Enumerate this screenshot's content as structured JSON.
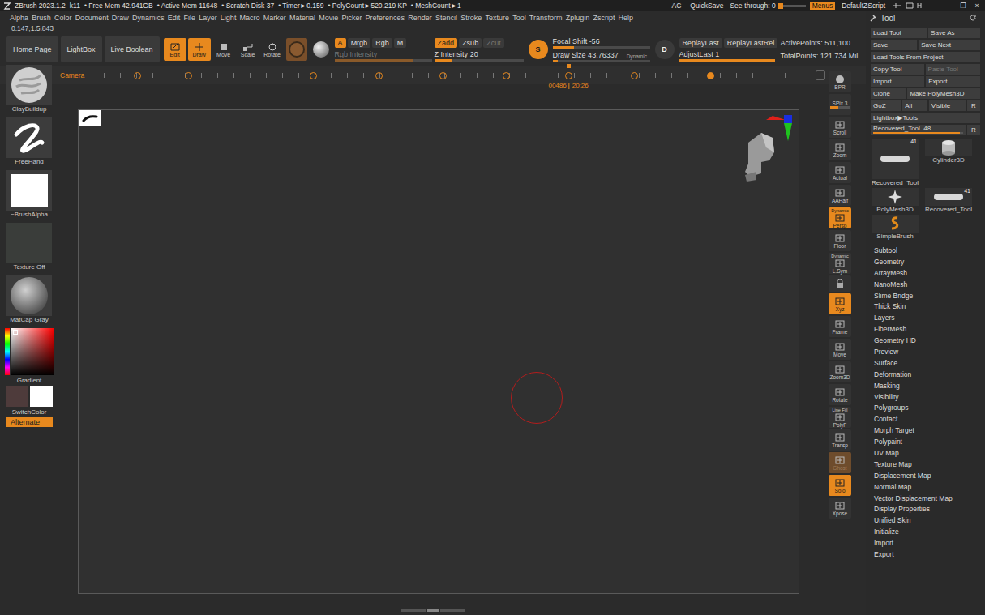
{
  "window": {
    "app": "ZBrush 2023.1.2",
    "status": [
      "k11",
      "• Free Mem 42.941GB",
      "• Active Mem 11648",
      "• Scratch Disk 37",
      "• Timer►0.159",
      "• PolyCount►520.219 KP",
      "• MeshCount►1"
    ],
    "right": [
      {
        "label": "AC",
        "selected": false
      },
      {
        "label": "QuickSave",
        "selected": false
      }
    ],
    "see_through": {
      "label": "See-through",
      "value": "0",
      "level": 0
    },
    "menus": {
      "label": "Menus",
      "selected": true
    },
    "script": "DefaultZScript",
    "controls": [
      "—",
      "❐",
      "×"
    ]
  },
  "menubar": [
    "Alpha",
    "Brush",
    "Color",
    "Document",
    "Draw",
    "Dynamics",
    "Edit",
    "File",
    "Layer",
    "Light",
    "Macro",
    "Marker",
    "Material",
    "Movie",
    "Picker",
    "Preferences",
    "Render",
    "Stencil",
    "Stroke",
    "Texture",
    "Tool",
    "Transform",
    "Zplugin",
    "Zscript",
    "Help"
  ],
  "coords": "0.147,1.5.843",
  "shelf": {
    "nav": [
      "Home Page",
      "LightBox",
      "Live Boolean"
    ],
    "modes": [
      {
        "label": "Edit",
        "selected": true
      },
      {
        "label": "Draw",
        "selected": true
      },
      {
        "label": "Move",
        "selected": false
      },
      {
        "label": "Scale",
        "selected": false
      },
      {
        "label": "Rotate",
        "selected": false
      }
    ],
    "rgb": [
      {
        "label": "A",
        "selected": true
      },
      {
        "label": "Mrgb",
        "selected": false
      },
      {
        "label": "Rgb",
        "selected": false
      },
      {
        "label": "M",
        "selected": false
      }
    ],
    "rgb_intensity": {
      "label": "Rgb Intensity",
      "level": 0.8,
      "disabled": true
    },
    "zmodes": [
      {
        "label": "Zadd",
        "selected": true,
        "disabled": false
      },
      {
        "label": "Zsub",
        "selected": false,
        "disabled": false
      },
      {
        "label": "Zcut",
        "selected": false,
        "disabled": true
      }
    ],
    "z_intensity": {
      "label": "Z Intensity 20",
      "level": 0.2
    },
    "s_button": "S",
    "focal_shift": {
      "label": "Focal Shift -56",
      "level": 0.22
    },
    "draw_size": {
      "label": "Draw Size 43.76337",
      "level": 0.05
    },
    "dynamic": "Dynamic",
    "d_button": "D",
    "replay": [
      "ReplayLast",
      "ReplayLastRel"
    ],
    "adjust_last": {
      "label": "AdjustLast 1",
      "level": 1
    },
    "active_points": "ActivePoints: 511,100",
    "total_points": "TotalPoints: 121.734 Mil"
  },
  "timeline": {
    "label": "Camera",
    "frame": "00486",
    "clock": "20:26",
    "cursor": 0.671,
    "keys": [
      {
        "pos": 0.048,
        "selected": false
      },
      {
        "pos": 0.121,
        "selected": false
      },
      {
        "pos": 0.302,
        "selected": false
      },
      {
        "pos": 0.397,
        "selected": false
      },
      {
        "pos": 0.489,
        "selected": false
      },
      {
        "pos": 0.581,
        "selected": false
      },
      {
        "pos": 0.671,
        "selected": false
      },
      {
        "pos": 0.766,
        "selected": false
      },
      {
        "pos": 0.876,
        "selected": true
      }
    ]
  },
  "tray": {
    "items": [
      {
        "label": "ClayBuildup",
        "kind": "brush"
      },
      {
        "label": "FreeHand",
        "kind": "stroke"
      },
      {
        "label": "~BrushAlpha",
        "kind": "alpha"
      },
      {
        "label": "Texture Off",
        "kind": "texture"
      },
      {
        "label": "MatCap Gray",
        "kind": "material"
      }
    ],
    "gradient": "Gradient",
    "switch_color": "SwitchColor",
    "alternate": {
      "label": "Alternate",
      "selected": true
    },
    "main_color": "#4e3b3b",
    "secondary_color": "#ffffff"
  },
  "rshelf": [
    {
      "label": "BPR",
      "sub": "",
      "selected": false,
      "dimmed": false
    },
    {
      "label": "SPix 3",
      "sub": "",
      "selected": false,
      "dimmed": false,
      "kind": "slider"
    },
    {
      "label": "Scroll",
      "sub": "",
      "selected": false,
      "dimmed": false
    },
    {
      "label": "Zoom",
      "sub": "",
      "selected": false,
      "dimmed": false
    },
    {
      "label": "Actual",
      "sub": "",
      "selected": false,
      "dimmed": false
    },
    {
      "label": "AAHalf",
      "sub": "",
      "selected": false,
      "dimmed": false
    },
    {
      "label": "Persp",
      "sub": "Dynamic",
      "selected": true,
      "dimmed": false
    },
    {
      "label": "Floor",
      "sub": "",
      "selected": false,
      "dimmed": false
    },
    {
      "label": "L.Sym",
      "sub": "Dynamic",
      "selected": false,
      "dimmed": false
    },
    {
      "label": "",
      "sub": "",
      "selected": false,
      "dimmed": false
    },
    {
      "label": "Xyz",
      "sub": "",
      "selected": true,
      "dimmed": false
    },
    {
      "label": "Frame",
      "sub": "",
      "selected": false,
      "dimmed": false
    },
    {
      "label": "Move",
      "sub": "",
      "selected": false,
      "dimmed": false
    },
    {
      "label": "Zoom3D",
      "sub": "",
      "selected": false,
      "dimmed": false
    },
    {
      "label": "Rotate",
      "sub": "",
      "selected": false,
      "dimmed": false
    },
    {
      "label": "PolyF",
      "sub": "Line Fill",
      "selected": false,
      "dimmed": false
    },
    {
      "label": "Transp",
      "sub": "",
      "selected": false,
      "dimmed": false
    },
    {
      "label": "Ghost",
      "sub": "",
      "selected": false,
      "dimmed": true
    },
    {
      "label": "Solo",
      "sub": "",
      "selected": true,
      "dimmed": false
    },
    {
      "label": "Xpose",
      "sub": "",
      "selected": false,
      "dimmed": false
    }
  ],
  "tool": {
    "title": "Tool",
    "rows": [
      [
        {
          "label": "Load Tool",
          "disabled": false
        },
        {
          "label": "Save As",
          "disabled": false
        }
      ],
      [
        {
          "label": "Save",
          "disabled": false
        },
        {
          "label": "Save Next",
          "disabled": false
        }
      ],
      [
        {
          "label": "Load Tools From Project",
          "disabled": false
        }
      ],
      [
        {
          "label": "Copy Tool",
          "disabled": false
        },
        {
          "label": "Paste Tool",
          "disabled": true
        }
      ],
      [
        {
          "label": "Import",
          "disabled": false
        },
        {
          "label": "Export",
          "disabled": false
        }
      ],
      [
        {
          "label": "Clone",
          "disabled": false
        },
        {
          "label": "Make PolyMesh3D",
          "disabled": false
        }
      ],
      [
        {
          "label": "GoZ",
          "disabled": false
        },
        {
          "label": "All",
          "disabled": false
        },
        {
          "label": "Visible",
          "disabled": false
        },
        {
          "label": "R",
          "disabled": false
        }
      ],
      [
        {
          "label": "Lightbox▶Tools",
          "disabled": false
        }
      ]
    ],
    "slider": {
      "label": "Recovered_Tool. 48",
      "level": 0.96,
      "button": "R"
    },
    "thumbs": [
      {
        "label": "Recovered_Tool",
        "count": "41",
        "kind": "large"
      },
      {
        "label": "Cylinder3D",
        "count": "",
        "kind": "cylinder"
      },
      {
        "label": "PolyMesh3D",
        "count": "",
        "kind": "star"
      },
      {
        "label": "Recovered_Tool",
        "count": "41",
        "kind": "small"
      },
      {
        "label": "SimpleBrush",
        "count": "",
        "kind": "brush"
      }
    ],
    "sections": [
      "Subtool",
      "Geometry",
      "ArrayMesh",
      "NanoMesh",
      "Slime Bridge",
      "Thick Skin",
      "Layers",
      "FiberMesh",
      "Geometry HD",
      "Preview",
      "Surface",
      "Deformation",
      "Masking",
      "Visibility",
      "Polygroups",
      "Contact",
      "Morph Target",
      "Polypaint",
      "UV Map",
      "Texture Map",
      "Displacement Map",
      "Normal Map",
      "Vector Displacement Map",
      "Display Properties",
      "Unified Skin",
      "Initialize",
      "Import",
      "Export"
    ]
  }
}
